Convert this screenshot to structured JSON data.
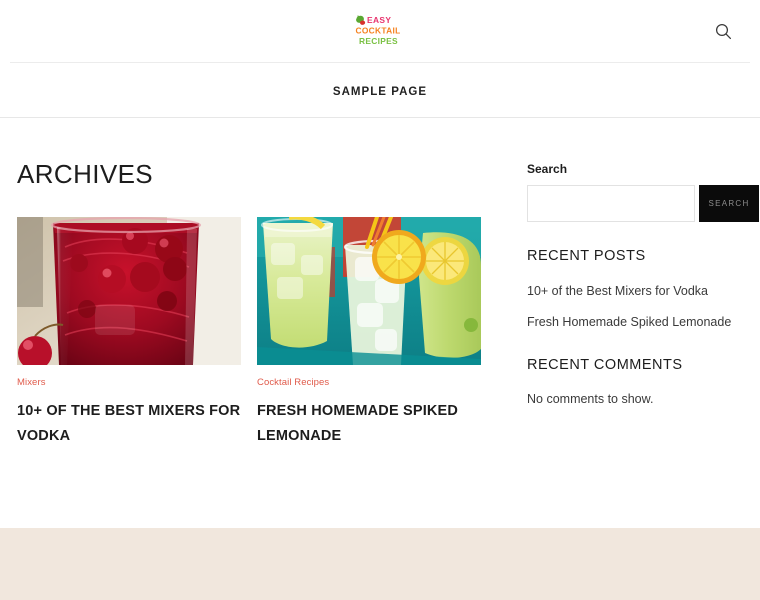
{
  "header": {
    "logo": {
      "icon": "cocktail-glass-icon",
      "line1": "EASY",
      "line2": "COCKTAIL",
      "line3": "RECIPES",
      "color_line1": "#e8336d",
      "color_line2": "#f58220",
      "color_line3": "#7ac143",
      "icon_color": "#5aa832"
    },
    "search_toggle_icon": "search-icon"
  },
  "nav": {
    "items": [
      {
        "label": "SAMPLE PAGE"
      }
    ]
  },
  "main": {
    "page_title": "ARCHIVES",
    "posts": [
      {
        "category": "Mixers",
        "title": "10+ OF THE BEST MIXERS FOR VODKA",
        "thumb_alt": "red-cocktail-with-cherries-photo"
      },
      {
        "category": "Cocktail Recipes",
        "title": "FRESH HOMEMADE SPIKED LEMONADE",
        "thumb_alt": "glasses-of-lemonade-with-lemon-slices-photo"
      }
    ]
  },
  "sidebar": {
    "search_widget": {
      "label": "Search",
      "input_value": "",
      "input_placeholder": "",
      "button_label": "SEARCH"
    },
    "recent_posts_widget": {
      "heading": "RECENT POSTS",
      "items": [
        {
          "label": "10+ of the Best Mixers for Vodka"
        },
        {
          "label": "Fresh Homemade Spiked Lemonade"
        }
      ]
    },
    "recent_comments_widget": {
      "heading": "RECENT COMMENTS",
      "empty_text": "No comments to show."
    }
  },
  "footer": {
    "background_color": "#f1e7dd"
  }
}
